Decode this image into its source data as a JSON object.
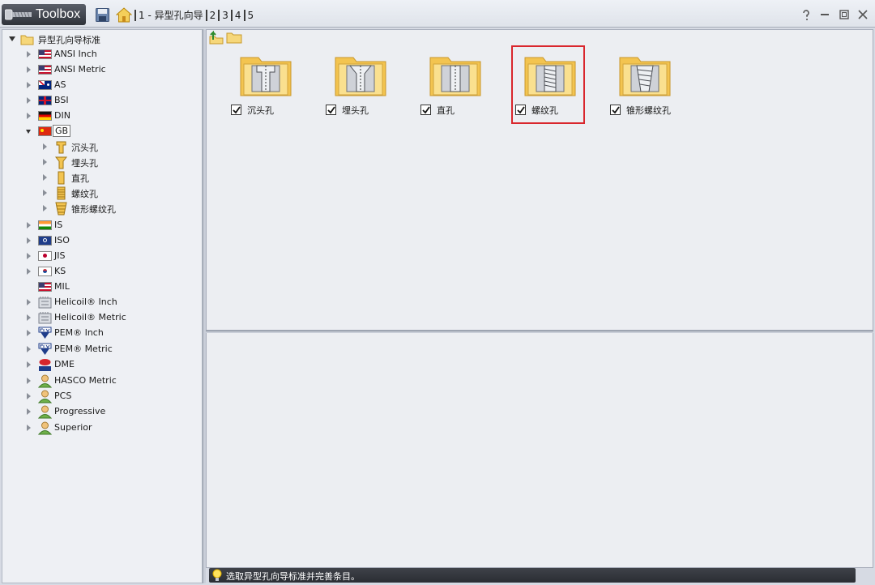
{
  "app": {
    "title": "Toolbox"
  },
  "breadcrumbs": [
    {
      "label": "1 - 异型孔向导"
    },
    {
      "label": "2"
    },
    {
      "label": "3"
    },
    {
      "label": "4"
    },
    {
      "label": "5"
    }
  ],
  "tree": {
    "root": "异型孔向导标准",
    "items": [
      {
        "label": "ANSI Inch",
        "icon": "us-flag-icon"
      },
      {
        "label": "ANSI Metric",
        "icon": "us-flag-icon"
      },
      {
        "label": "AS",
        "icon": "australia-flag-icon"
      },
      {
        "label": "BSI",
        "icon": "uk-flag-icon"
      },
      {
        "label": "DIN",
        "icon": "germany-flag-icon"
      },
      {
        "label": "GB",
        "icon": "china-flag-icon",
        "expanded": true,
        "selected": true
      },
      {
        "label": "IS",
        "icon": "india-flag-icon"
      },
      {
        "label": "ISO",
        "icon": "iso-flag-icon"
      },
      {
        "label": "JIS",
        "icon": "japan-flag-icon"
      },
      {
        "label": "KS",
        "icon": "korea-flag-icon"
      },
      {
        "label": "MIL",
        "icon": "us-flag-icon"
      },
      {
        "label": "Helicoil® Inch",
        "icon": "helicoil-icon"
      },
      {
        "label": "Helicoil® Metric",
        "icon": "helicoil-icon"
      },
      {
        "label": "PEM® Inch",
        "icon": "pem-icon"
      },
      {
        "label": "PEM® Metric",
        "icon": "pem-icon"
      },
      {
        "label": "DME",
        "icon": "dme-icon"
      },
      {
        "label": "HASCO Metric",
        "icon": "user-icon"
      },
      {
        "label": "PCS",
        "icon": "user-icon"
      },
      {
        "label": "Progressive",
        "icon": "user-icon"
      },
      {
        "label": "Superior",
        "icon": "user-icon"
      }
    ],
    "gb_children": [
      {
        "label": "沉头孔"
      },
      {
        "label": "埋头孔"
      },
      {
        "label": "直孔"
      },
      {
        "label": "螺纹孔"
      },
      {
        "label": "锥形螺纹孔"
      }
    ]
  },
  "holes": [
    {
      "label": "沉头孔",
      "checked": true
    },
    {
      "label": "埋头孔",
      "checked": true
    },
    {
      "label": "直孔",
      "checked": true
    },
    {
      "label": "螺纹孔",
      "checked": true,
      "highlighted": true
    },
    {
      "label": "锥形螺纹孔",
      "checked": true
    }
  ],
  "status": {
    "text": "选取异型孔向导标准并完善条目。"
  },
  "colors": {
    "highlight": "#d9262d",
    "folder": "#f3c450",
    "status_bar": "#2f3238"
  }
}
